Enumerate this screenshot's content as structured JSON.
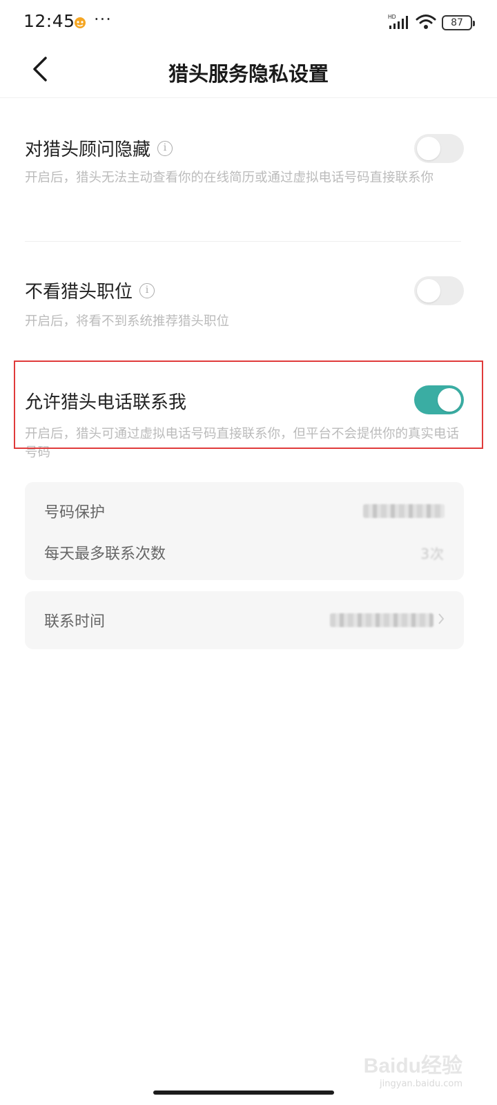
{
  "status_bar": {
    "time": "12:45",
    "more": "···",
    "network_label": "HD",
    "battery": "87"
  },
  "nav": {
    "back_icon": "chevron-left-icon",
    "title": "猎头服务隐私设置"
  },
  "settings": [
    {
      "title": "对猎头顾问隐藏",
      "has_info": true,
      "description": "开启后，猎头无法主动查看你的在线简历或通过虚拟电话号码直接联系你",
      "enabled": false
    },
    {
      "title": "不看猎头职位",
      "has_info": true,
      "description": "开启后，将看不到系统推荐猎头职位",
      "enabled": false
    },
    {
      "title": "允许猎头电话联系我",
      "has_info": false,
      "description": "开启后，猎头可通过虚拟电话号码直接联系你，但平台不会提供你的真实电话号码",
      "enabled": true
    }
  ],
  "phone_card": {
    "rows": [
      {
        "label": "号码保护",
        "value": ""
      },
      {
        "label": "每天最多联系次数",
        "value": "3次"
      }
    ]
  },
  "time_card": {
    "label": "联系时间",
    "value": ""
  },
  "watermark": {
    "logo": "Baidu经验",
    "sub": "jingyan.baidu.com"
  },
  "colors": {
    "toggle_on": "#3aada3",
    "toggle_off": "#ececec",
    "highlight": "#e03a3a"
  }
}
